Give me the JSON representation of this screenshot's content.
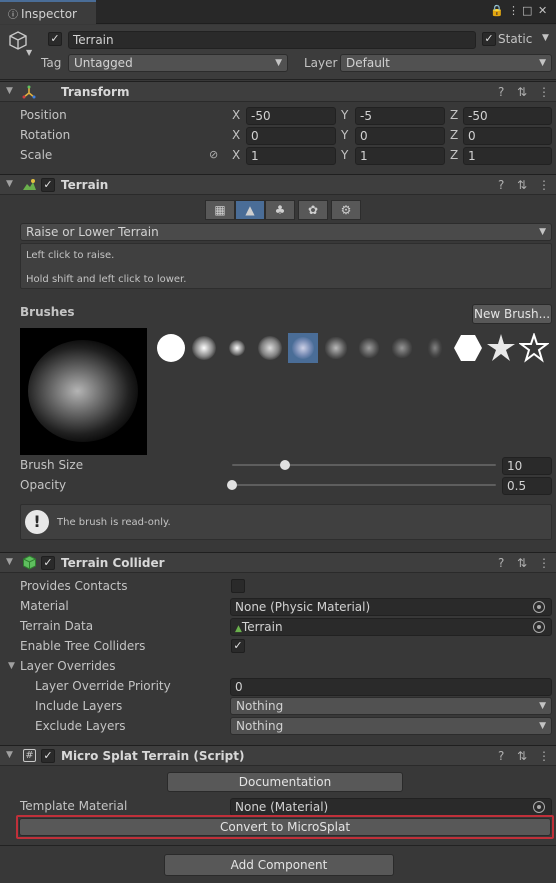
{
  "tab": {
    "title": "Inspector"
  },
  "gameobject": {
    "name": "Terrain",
    "static_label": "Static",
    "tag_label": "Tag",
    "tag_value": "Untagged",
    "layer_label": "Layer",
    "layer_value": "Default"
  },
  "transform": {
    "title": "Transform",
    "position_label": "Position",
    "rotation_label": "Rotation",
    "scale_label": "Scale",
    "axis_x": "X",
    "axis_y": "Y",
    "axis_z": "Z",
    "position": {
      "x": "-50",
      "y": "-5",
      "z": "-50"
    },
    "rotation": {
      "x": "0",
      "y": "0",
      "z": "0"
    },
    "scale": {
      "x": "1",
      "y": "1",
      "z": "1"
    }
  },
  "terrain": {
    "title": "Terrain",
    "mode": "Raise or Lower Terrain",
    "help_line1": "Left click to raise.",
    "help_line2": "Hold shift and left click to lower.",
    "brushes_label": "Brushes",
    "new_brush_label": "New Brush...",
    "brush_size_label": "Brush Size",
    "brush_size_value": "10",
    "brush_size_fraction": 0.2,
    "opacity_label": "Opacity",
    "opacity_value": "0.5",
    "opacity_fraction": 0.0,
    "readonly_msg": "The brush is read-only."
  },
  "collider": {
    "title": "Terrain Collider",
    "provides_contacts_label": "Provides Contacts",
    "material_label": "Material",
    "material_value": "None (Physic Material)",
    "terrain_data_label": "Terrain Data",
    "terrain_data_value": "Terrain",
    "enable_tree_label": "Enable Tree Colliders",
    "layer_overrides_label": "Layer Overrides",
    "override_priority_label": "Layer Override Priority",
    "override_priority_value": "0",
    "include_layers_label": "Include Layers",
    "include_layers_value": "Nothing",
    "exclude_layers_label": "Exclude Layers",
    "exclude_layers_value": "Nothing"
  },
  "microsplat": {
    "title": "Micro Splat Terrain (Script)",
    "documentation_label": "Documentation",
    "template_label": "Template Material",
    "template_value": "None (Material)",
    "convert_label": "Convert to MicroSplat"
  },
  "footer": {
    "add_component_label": "Add Component"
  },
  "colors": {
    "accent": "#4a6d97",
    "highlight": "#c0303a"
  }
}
